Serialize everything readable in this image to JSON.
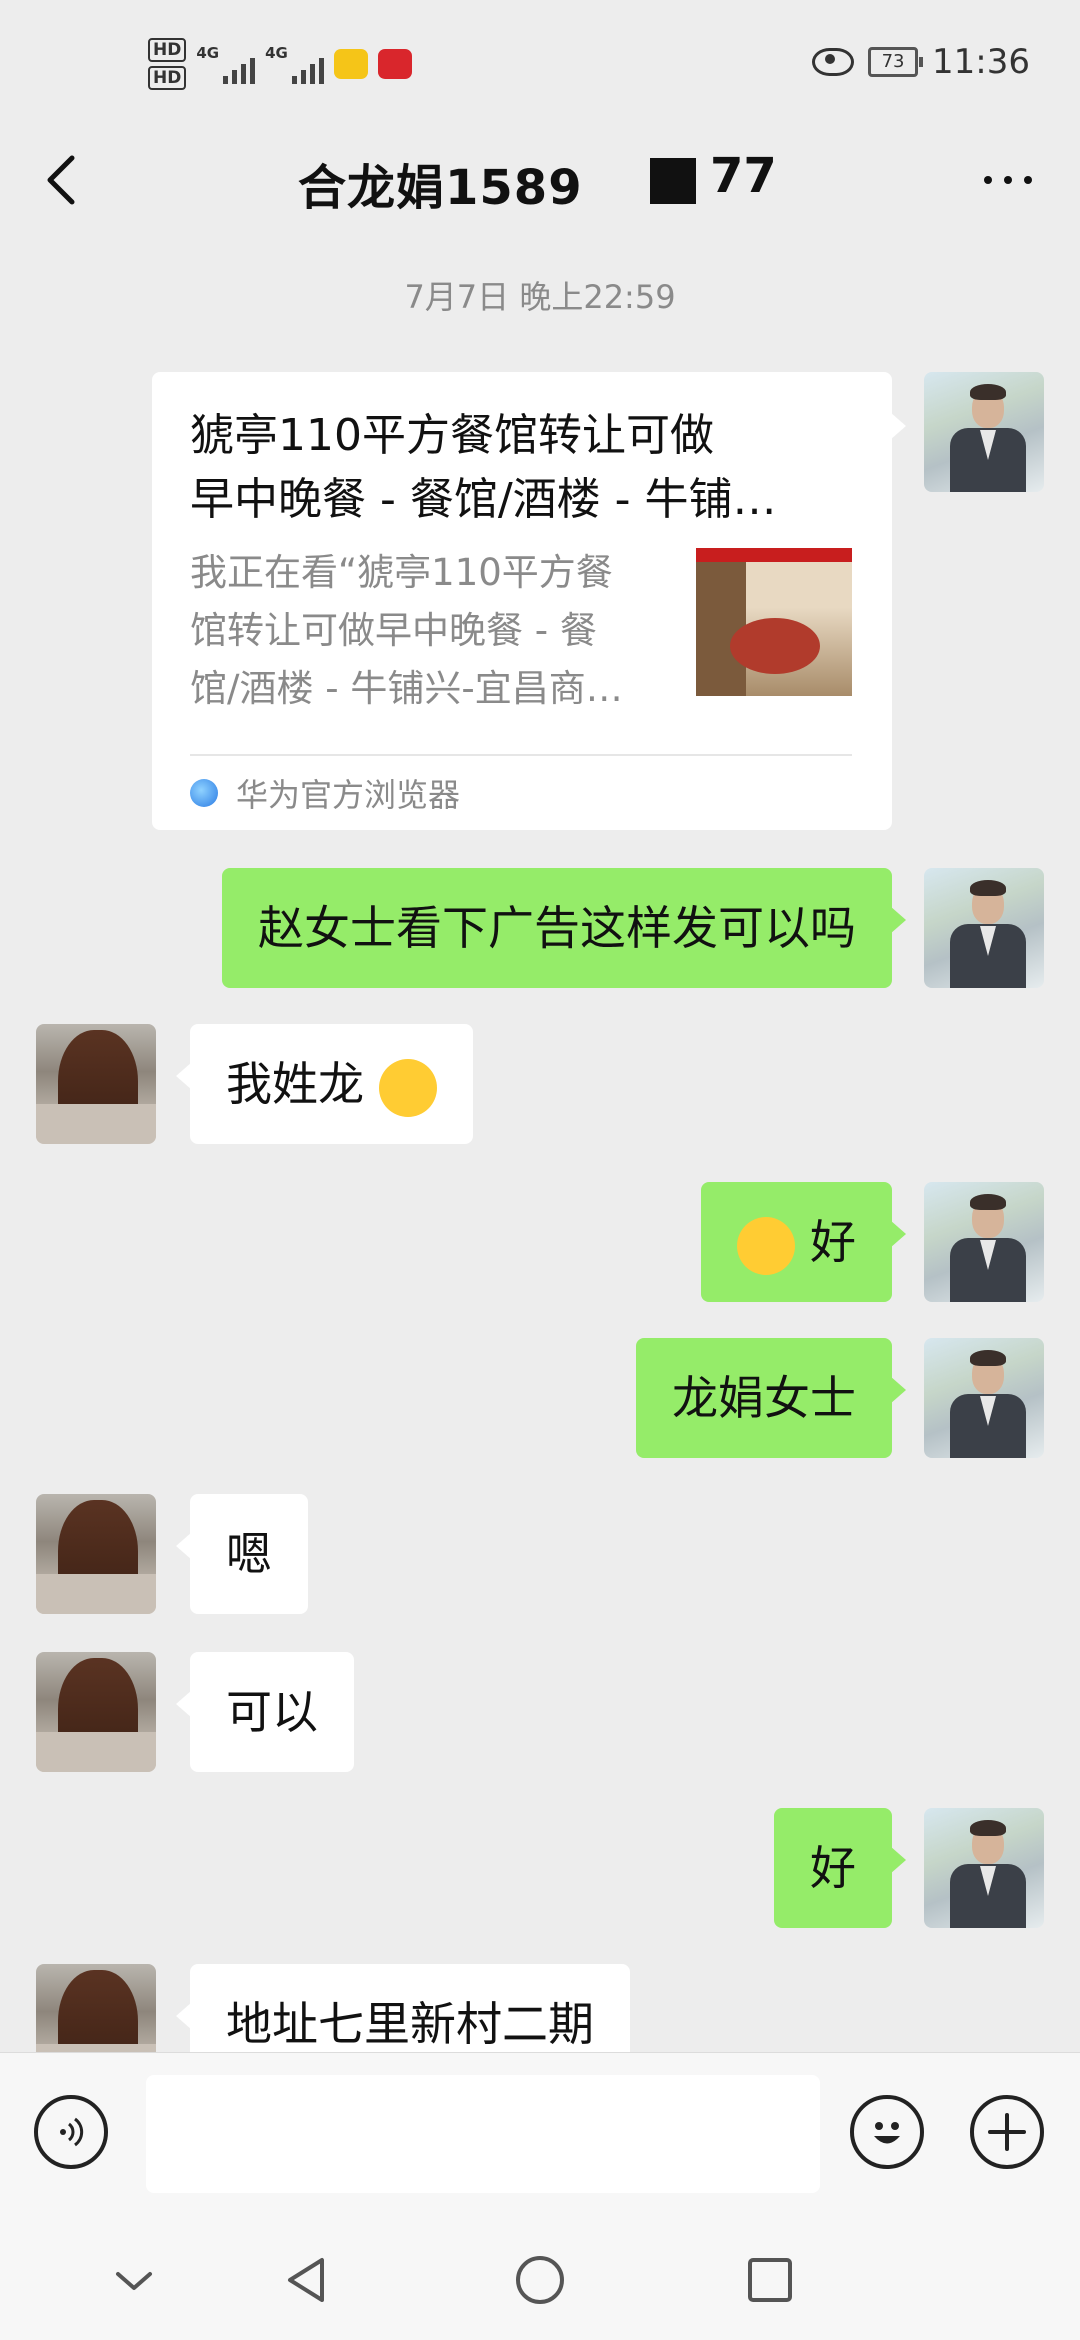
{
  "status_bar": {
    "hd1": "HD",
    "hd2": "HD",
    "net1": "4G",
    "net2": "4G",
    "battery": "73",
    "time": "11:36",
    "app_icons": [
      "mail-app-icon",
      "youdao-app-icon"
    ]
  },
  "header": {
    "title_visible": "合龙娟1589",
    "title_tail": "77",
    "back_icon": "chevron-left-icon",
    "more_icon": "more-dots-icon"
  },
  "chat": {
    "timestamp": "7月7日 晚上22:59",
    "link_card": {
      "title": "猇亭110平方餐馆转让可做早中晚餐 - 餐馆/酒楼 - 牛铺…",
      "title_line1": "猇亭110平方餐馆转让可做",
      "title_line2": "早中晚餐 - 餐馆/酒楼 - 牛铺…",
      "desc_line1": "我正在看“猇亭110平方餐",
      "desc_line2": "馆转让可做早中晚餐 - 餐",
      "desc_line3": "馆/酒楼 - 牛铺兴-宜昌商…",
      "source": "华为官方浏览器"
    },
    "messages": [
      {
        "side": "right",
        "text": "赵女士看下广告这样发可以吗"
      },
      {
        "side": "left",
        "text": "我姓龙",
        "emoji": "hand-over-mouth-emoji"
      },
      {
        "side": "right",
        "text": "好",
        "emoji": "crying-laughing-emoji"
      },
      {
        "side": "right",
        "text": "龙娟女士"
      },
      {
        "side": "left",
        "text": "嗯"
      },
      {
        "side": "left",
        "text": "可以"
      },
      {
        "side": "right",
        "text": "好"
      },
      {
        "side": "left",
        "text": "地址七里新村二期"
      }
    ]
  },
  "input_bar": {
    "placeholder": "",
    "voice_icon": "voice-icon",
    "emoji_icon": "smiley-icon",
    "plus_icon": "plus-icon"
  },
  "nav_bar": {
    "icons": [
      "chevron-down-icon",
      "nav-back-icon",
      "nav-home-icon",
      "nav-recents-icon"
    ]
  },
  "colors": {
    "background": "#ededed",
    "sent_bubble": "#95ec69",
    "received_bubble": "#ffffff"
  }
}
